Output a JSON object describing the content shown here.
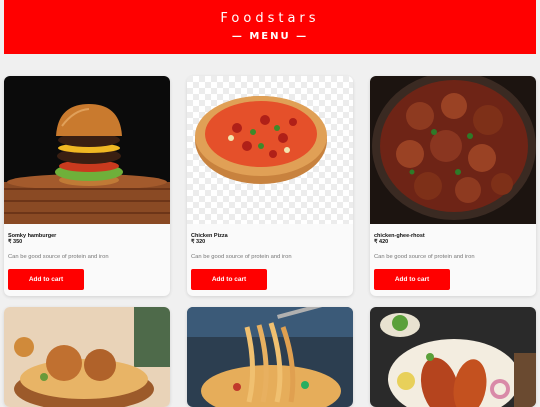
{
  "header": {
    "brand": "Foodstars",
    "menu_title": "— MENU —"
  },
  "colors": {
    "accent": "#ff0000",
    "background": "#f0f0f0"
  },
  "items": [
    {
      "name": "Somky hamburger",
      "price": "₹ 350",
      "description": "Can be good source of protein and iron",
      "button": "Add to cart",
      "image": "burger-image"
    },
    {
      "name": "Chicken Pizza",
      "price": "₹ 320",
      "description": "Can be good source of protein and iron",
      "button": "Add to cart",
      "image": "pizza-image"
    },
    {
      "name": "chicken-ghee-rhost",
      "price": "₹ 420",
      "description": "Can be good source of protein and iron",
      "button": "Add to cart",
      "image": "chicken-roast-image"
    },
    {
      "image": "biryani-image"
    },
    {
      "image": "noodles-image"
    },
    {
      "image": "fish-fry-image"
    }
  ]
}
